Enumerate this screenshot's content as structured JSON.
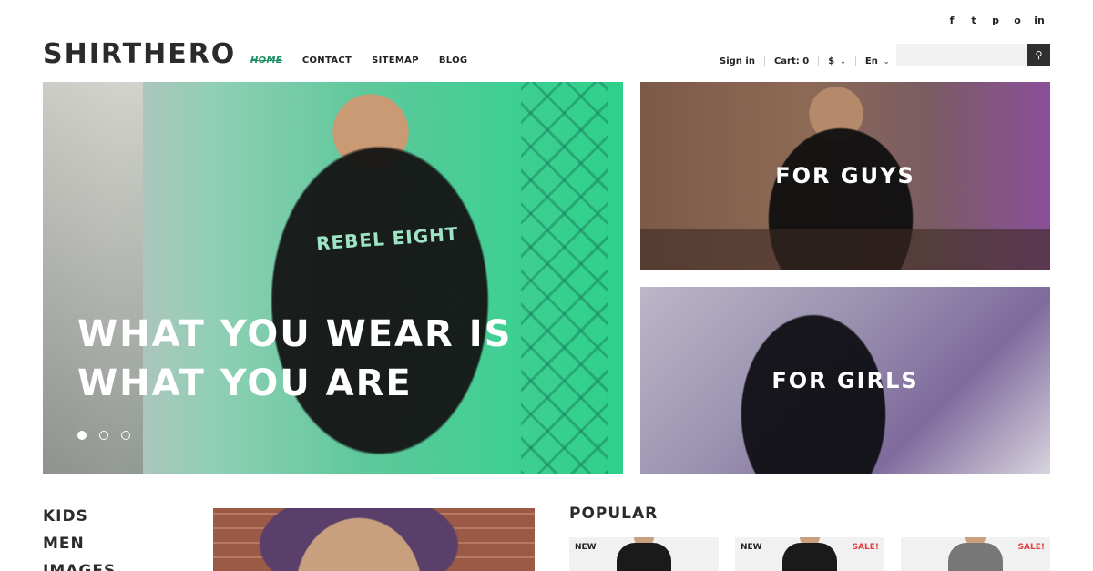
{
  "social": {
    "icons": [
      "facebook-icon",
      "twitter-icon",
      "pinterest-icon",
      "instagram-icon",
      "linkedin-icon"
    ],
    "glyphs": [
      "f",
      "t",
      "p",
      "o",
      "in"
    ]
  },
  "header": {
    "logo": "SHIRTHERO",
    "nav": [
      "HOME",
      "CONTACT",
      "SITEMAP",
      "BLOG"
    ],
    "sign_in": "Sign in",
    "cart": "Cart: 0",
    "currency": "$",
    "language": "En",
    "search": {
      "placeholder": "",
      "button_icon": "search-icon"
    }
  },
  "hero": {
    "headline_line1": "WHAT YOU WEAR IS",
    "headline_line2": "WHAT YOU ARE",
    "shirt_print": "REBEL EIGHT",
    "slides": 3,
    "active_slide": 1
  },
  "tiles": {
    "guys": "FOR GUYS",
    "girls": "FOR GIRLS"
  },
  "categories": [
    "KIDS",
    "MEN",
    "IMAGES"
  ],
  "popular": {
    "title": "POPULAR",
    "products": [
      {
        "badge": "NEW",
        "sale": ""
      },
      {
        "badge": "NEW",
        "sale": "SALE!"
      },
      {
        "badge": "",
        "sale": "SALE!"
      }
    ]
  },
  "colors": {
    "accent": "#1f8f66",
    "sale": "#e0413d",
    "search_button": "#2f2f2f"
  }
}
